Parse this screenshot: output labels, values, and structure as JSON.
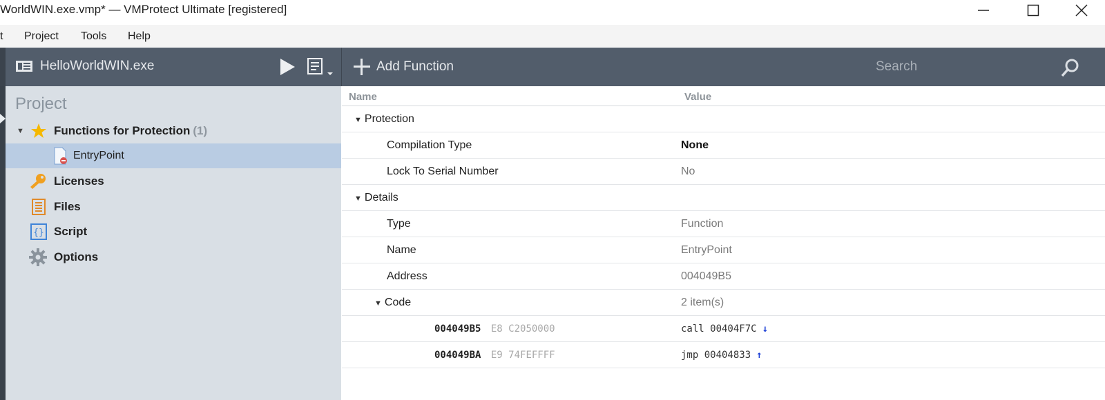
{
  "window": {
    "title": "WorldWIN.exe.vmp* — VMProtect Ultimate [registered]"
  },
  "menu": {
    "items": [
      "t",
      "Project",
      "Tools",
      "Help"
    ]
  },
  "toolbar": {
    "file_name": "HelloWorldWIN.exe",
    "add_function_label": "Add Function",
    "search_placeholder": "Search"
  },
  "project_tree": {
    "header": "Project",
    "functions_label": "Functions for Protection",
    "functions_count": "(1)",
    "entry_point": "EntryPoint",
    "licenses": "Licenses",
    "files": "Files",
    "script": "Script",
    "options": "Options"
  },
  "grid": {
    "col_name": "Name",
    "col_value": "Value",
    "protection": {
      "label": "Protection",
      "compilation_type_label": "Compilation Type",
      "compilation_type_value": "None",
      "lock_serial_label": "Lock To Serial Number",
      "lock_serial_value": "No"
    },
    "details": {
      "label": "Details",
      "type_label": "Type",
      "type_value": "Function",
      "name_label": "Name",
      "name_value": "EntryPoint",
      "address_label": "Address",
      "address_value": "004049B5",
      "code_label": "Code",
      "code_value": "2 item(s)"
    },
    "code_lines": [
      {
        "address": "004049B5",
        "bytes": "E8 C2050000",
        "asm": "call 00404F7C",
        "arrow": "↓"
      },
      {
        "address": "004049BA",
        "bytes": "E9 74FEFFFF",
        "asm": "jmp 00404833",
        "arrow": "↑"
      }
    ]
  },
  "colors": {
    "toolbar_bg": "#525d6b",
    "left_panel_bg": "#d9dfe5",
    "selection_bg": "#b9cce3",
    "star": "#f5b800",
    "key": "#f0a020",
    "files_icon": "#e08a2a",
    "script_icon": "#3f84d8",
    "jump_arrow": "#1b3fd6"
  }
}
